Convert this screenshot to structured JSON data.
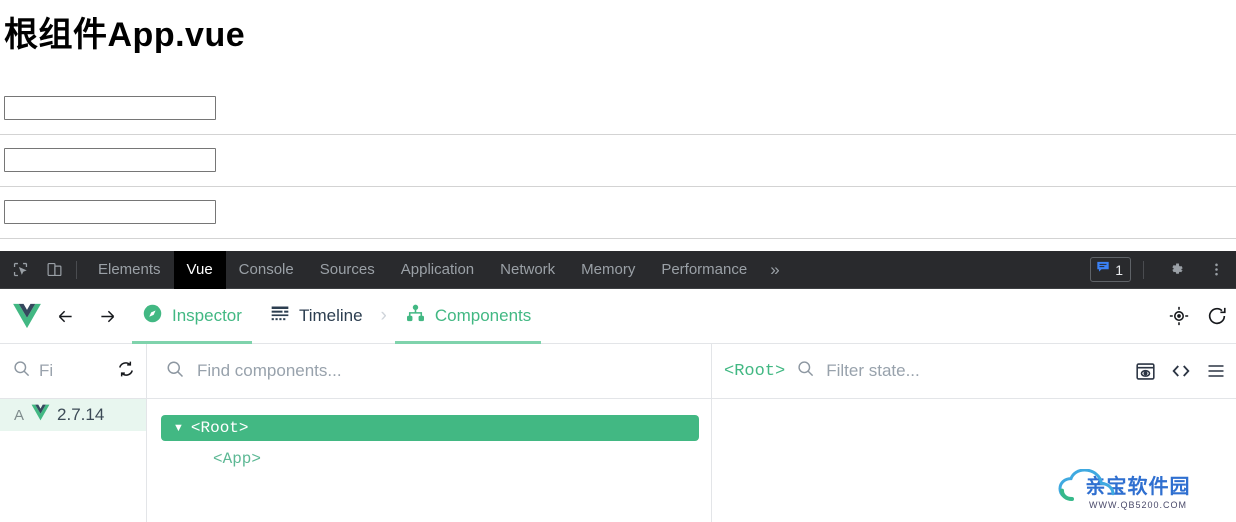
{
  "page": {
    "title": "根组件App.vue",
    "inputs": [
      {
        "name": "input-1",
        "value": "",
        "placeholder": ""
      },
      {
        "name": "input-2",
        "value": "",
        "placeholder": ""
      },
      {
        "name": "input-3",
        "value": "",
        "placeholder": ""
      }
    ]
  },
  "devtools": {
    "tabs": [
      {
        "label": "Elements",
        "active": false
      },
      {
        "label": "Vue",
        "active": true
      },
      {
        "label": "Console",
        "active": false
      },
      {
        "label": "Sources",
        "active": false
      },
      {
        "label": "Application",
        "active": false
      },
      {
        "label": "Network",
        "active": false
      },
      {
        "label": "Memory",
        "active": false
      },
      {
        "label": "Performance",
        "active": false
      }
    ],
    "more_label": "»",
    "issues_count": "1",
    "icons": {
      "inspect": "inspect-element-icon",
      "device": "device-toolbar-icon",
      "issues": "issues-speech-bubble-icon",
      "settings": "gear-icon",
      "overflow": "vertical-dots-icon"
    },
    "colors": {
      "toolbar_bg": "#292a2d",
      "active_tab_bg": "#000000",
      "tab_text": "#9aa0a6",
      "badge_blue": "#3b82f6"
    }
  },
  "vue_nav": {
    "logo": "vue-logo",
    "back_label": "←",
    "forward_label": "→",
    "tabs": [
      {
        "label": "Inspector",
        "icon": "compass-icon",
        "active": true
      },
      {
        "label": "Timeline",
        "icon": "timeline-icon",
        "active": false
      },
      {
        "label": "Components",
        "icon": "component-tree-icon",
        "active": true
      }
    ],
    "chevron": "›",
    "actions": [
      {
        "name": "select-component-icon"
      },
      {
        "name": "refresh-icon"
      }
    ],
    "accent": "#42b883"
  },
  "filters": {
    "sidebar_search_placeholder": "Fi",
    "sidebar_refresh": "sync-icon",
    "tree_search_placeholder": "Find components...",
    "state_root_label": "<Root>",
    "state_search_placeholder": "Filter state...",
    "state_actions": [
      {
        "name": "inspect-dom-icon"
      },
      {
        "name": "open-in-editor-icon"
      },
      {
        "name": "menu-icon"
      }
    ]
  },
  "sidebar": {
    "app_letter": "A",
    "vue_version": "2.7.14"
  },
  "tree": {
    "nodes": [
      {
        "label": "<Root>",
        "selected": true,
        "caret": "▼",
        "depth": 0
      },
      {
        "label": "<App>",
        "selected": false,
        "caret": "",
        "depth": 1
      }
    ]
  },
  "watermark": {
    "text": "亲宝软件园",
    "url": "WWW.QB5200.COM"
  }
}
